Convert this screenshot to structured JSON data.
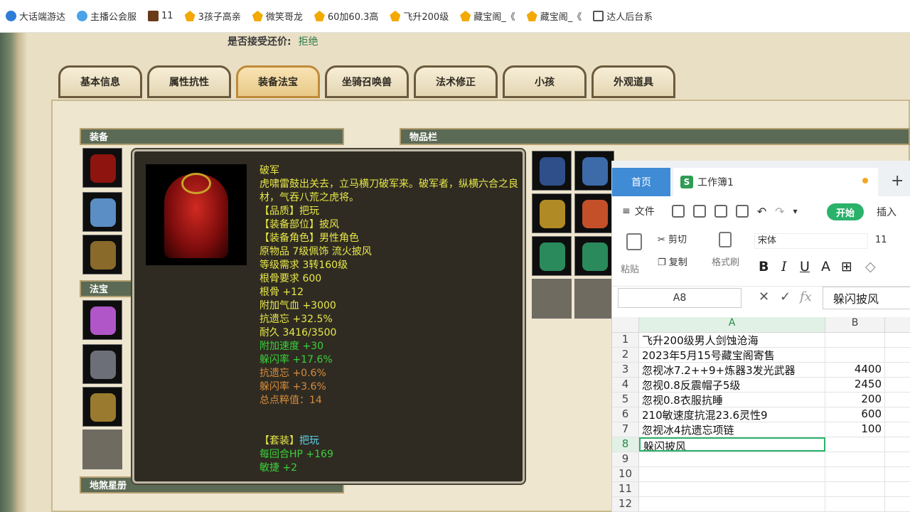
{
  "bookmarks": [
    {
      "label": "大话端游达",
      "icon": "c-logo-icon"
    },
    {
      "label": "主播公会服",
      "icon": "globe-icon"
    },
    {
      "label": "11",
      "icon": "game-icon"
    },
    {
      "label": "3孩子高亲",
      "icon": "star-icon"
    },
    {
      "label": "微笑哥龙",
      "icon": "star-icon"
    },
    {
      "label": "60加60.3高",
      "icon": "star-icon"
    },
    {
      "label": "飞升200级",
      "icon": "star-icon"
    },
    {
      "label": "藏宝阁_《",
      "icon": "star-icon"
    },
    {
      "label": "藏宝阁_《",
      "icon": "star-icon"
    },
    {
      "label": "达人后台系",
      "icon": "doc-icon"
    }
  ],
  "game": {
    "offer_label": "是否接受还价:",
    "offer_value": "拒绝",
    "tabs": [
      "基本信息",
      "属性抗性",
      "装备法宝",
      "坐骑召唤兽",
      "法术修正",
      "小孩",
      "外观道具"
    ],
    "active_tab": "装备法宝",
    "sections": {
      "equipment": "装备",
      "inventory": "物品栏",
      "treasure": "法宝",
      "star": "地煞星册"
    }
  },
  "tooltip": {
    "name": "破军",
    "desc": "虎啸雷鼓出关去，立马横刀破军来。破军者，纵横六合之良材，气吞八荒之虎将。",
    "lines_yellow": [
      "【品质】把玩",
      "【装备部位】披风",
      "【装备角色】男性角色",
      "原物品 7级佩饰 流火披风",
      "等级需求 3转160级",
      "根骨要求 600",
      "根骨 +12",
      "附加气血 +3000",
      "抗遗忘 +32.5%",
      "耐久 3416/3500"
    ],
    "lines_green": [
      "附加速度 +30",
      "躲闪率 +17.6%"
    ],
    "lines_orange": [
      "抗遗忘 +0.6%",
      "躲闪率 +3.6%",
      "总点粹值：14"
    ],
    "set_label": "【套装】",
    "set_value": "把玩",
    "set_lines": [
      "每回合HP +169",
      "敏捷 +2"
    ]
  },
  "spreadsheet": {
    "tab_home": "首页",
    "tab_workbook": "工作簿1",
    "menu_file": "文件",
    "btn_start": "开始",
    "menu_insert": "插入",
    "toolbar": {
      "paste": "粘贴",
      "cut": "剪切",
      "copy": "复制",
      "format_painter": "格式刷",
      "font": "宋体",
      "font_size": "11"
    },
    "name_box": "A8",
    "formula": "躲闪披风",
    "col_a": "A",
    "col_b": "B",
    "rows": [
      {
        "n": "1",
        "a": "飞升200级男人剑蚀沧海",
        "b": ""
      },
      {
        "n": "2",
        "a": "2023年5月15号藏宝阁寄售",
        "b": ""
      },
      {
        "n": "3",
        "a": "忽视冰7.2++9+炼器3发光武器",
        "b": "4400"
      },
      {
        "n": "4",
        "a": "忽视0.8反震帽子5级",
        "b": "2450"
      },
      {
        "n": "5",
        "a": "忽视0.8衣服抗睡",
        "b": "200"
      },
      {
        "n": "6",
        "a": "210敏速度抗混23.6灵性9",
        "b": "600"
      },
      {
        "n": "7",
        "a": "忽视冰4抗遗忘项链",
        "b": "100"
      },
      {
        "n": "8",
        "a": "躲闪披风",
        "b": ""
      },
      {
        "n": "9",
        "a": "",
        "b": ""
      },
      {
        "n": "10",
        "a": "",
        "b": ""
      },
      {
        "n": "11",
        "a": "",
        "b": ""
      },
      {
        "n": "12",
        "a": "",
        "b": ""
      }
    ]
  }
}
